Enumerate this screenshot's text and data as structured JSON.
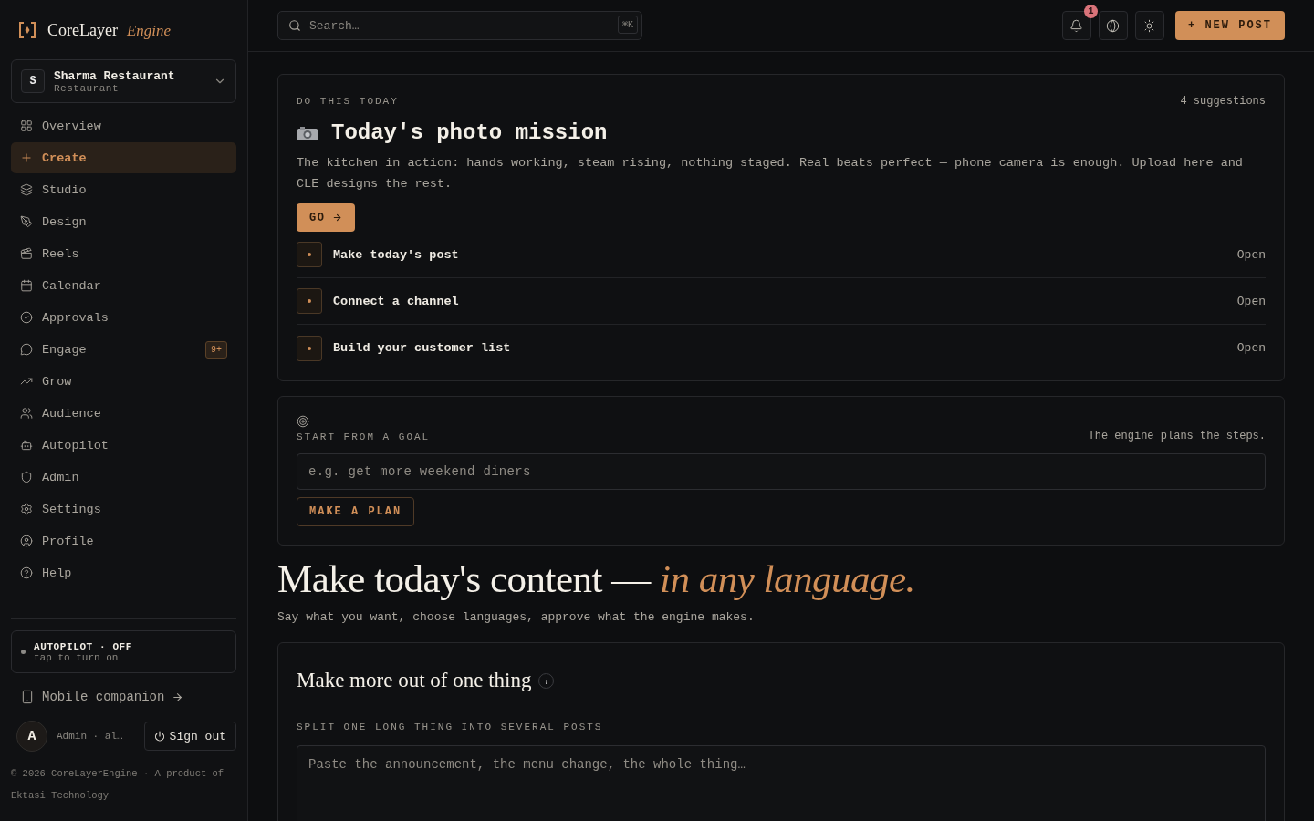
{
  "brand": {
    "name": "CoreLayer",
    "accent": "Engine"
  },
  "workspace": {
    "initial": "S",
    "name": "Sharma Restaurant",
    "type": "Restaurant"
  },
  "nav": [
    {
      "label": "Overview",
      "selected": false
    },
    {
      "label": "Create",
      "selected": true
    },
    {
      "label": "Studio",
      "selected": false
    },
    {
      "label": "Design",
      "selected": false
    },
    {
      "label": "Reels",
      "selected": false
    },
    {
      "label": "Calendar",
      "selected": false
    },
    {
      "label": "Approvals",
      "selected": false
    },
    {
      "label": "Engage",
      "selected": false,
      "badge": "9+"
    },
    {
      "label": "Grow",
      "selected": false
    },
    {
      "label": "Audience",
      "selected": false
    },
    {
      "label": "Autopilot",
      "selected": false
    },
    {
      "label": "Admin",
      "selected": false
    },
    {
      "label": "Settings",
      "selected": false
    },
    {
      "label": "Profile",
      "selected": false
    },
    {
      "label": "Help",
      "selected": false
    }
  ],
  "autopilot": {
    "title": "AUTOPILOT · OFF",
    "hint": "tap to turn on",
    "on": false
  },
  "mobile_link": "Mobile companion",
  "user": {
    "initial": "A",
    "label": "Admin · al…"
  },
  "sign_out": "Sign out",
  "footer": "© 2026 CoreLayerEngine · A product of Ektasi Technology",
  "topbar": {
    "search": {
      "placeholder": "Search…",
      "shortcut": "⌘K"
    },
    "notifications": "1",
    "new_post": "+ NEW POST"
  },
  "mission": {
    "eyebrow": "DO THIS TODAY",
    "count": "4 suggestions",
    "title": "Today's photo mission",
    "description": "The kitchen in action: hands working, steam rising, nothing staged. Real beats perfect — phone camera is enough. Upload here and CLE designs the rest.",
    "go": "GO",
    "tasks": [
      {
        "label": "Make today's post",
        "action": "Open"
      },
      {
        "label": "Connect a channel",
        "action": "Open"
      },
      {
        "label": "Build your customer list",
        "action": "Open"
      }
    ]
  },
  "goal": {
    "eyebrow": "START FROM A GOAL",
    "hint": "The engine plans the steps.",
    "placeholder": "e.g. get more weekend diners",
    "button": "MAKE A PLAN"
  },
  "hero": {
    "title": "Make today's content — ",
    "accent": "in any language.",
    "subtitle": "Say what you want, choose languages, approve what the engine makes."
  },
  "repurpose": {
    "title": "Make more out of one thing",
    "info": "i",
    "eyebrow": "SPLIT ONE LONG THING INTO SEVERAL POSTS",
    "placeholder": "Paste the announcement, the menu change, the whole thing…"
  }
}
